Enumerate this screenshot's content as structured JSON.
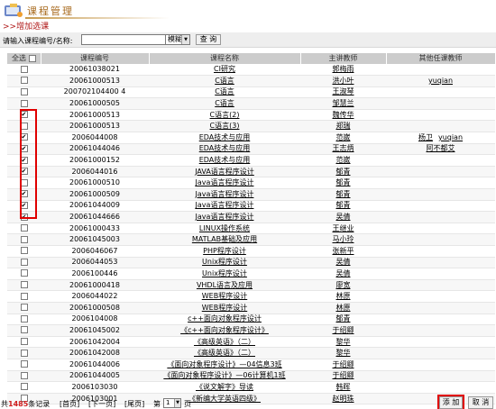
{
  "window": {
    "title": "课程管理"
  },
  "subhead": ">>增加选课",
  "search": {
    "label": "请输入课程编号/名称:",
    "value": "",
    "mode_selected": "模糊",
    "button_label": "查 询"
  },
  "table": {
    "headers": [
      "全选",
      "课程编号",
      "课程名称",
      "主讲教师",
      "其他任课教师"
    ],
    "rows": [
      {
        "checked": false,
        "code": "20061038021",
        "name": "CI研究",
        "teacher": "郭梅雨",
        "others": []
      },
      {
        "checked": false,
        "code": "20061000513",
        "name": "C语言",
        "teacher": "洪小叶",
        "others": [
          "yuqian"
        ]
      },
      {
        "checked": false,
        "code": "200702104400 4",
        "name": "C语言",
        "teacher": "王淑琴",
        "others": []
      },
      {
        "checked": false,
        "code": "20061000505",
        "name": "C语言",
        "teacher": "邹慧兰",
        "others": []
      },
      {
        "checked": true,
        "code": "20061000513",
        "name": "C语言(2)",
        "teacher": "魏传华",
        "others": []
      },
      {
        "checked": false,
        "code": "20061000513",
        "name": "C语言(3)",
        "teacher": "郑瑞",
        "others": []
      },
      {
        "checked": true,
        "code": "2006044008",
        "name": "EDA技术与应用",
        "teacher": "范崴",
        "others": [
          "杨卫",
          "yuqian"
        ]
      },
      {
        "checked": true,
        "code": "20061044046",
        "name": "EDA技术与应用",
        "teacher": "王志炳",
        "others": [
          "阿不都艾"
        ]
      },
      {
        "checked": true,
        "code": "20061000152",
        "name": "EDA技术与应用",
        "teacher": "范崴",
        "others": []
      },
      {
        "checked": true,
        "code": "2006044016",
        "name": "JAVA语言程序设计",
        "teacher": "郁青",
        "others": []
      },
      {
        "checked": false,
        "code": "20061000510",
        "name": "Java语言程序设计",
        "teacher": "郁青",
        "others": []
      },
      {
        "checked": true,
        "code": "20061000509",
        "name": "Java语言程序设计",
        "teacher": "郁青",
        "others": []
      },
      {
        "checked": true,
        "code": "20061044009",
        "name": "Java语言程序设计",
        "teacher": "郁青",
        "others": []
      },
      {
        "checked": true,
        "code": "20061044666",
        "name": "Java语言程序设计",
        "teacher": "吴倩",
        "others": []
      },
      {
        "checked": false,
        "code": "20061000433",
        "name": "LINUX操作系统",
        "teacher": "王继业",
        "others": []
      },
      {
        "checked": false,
        "code": "20061045003",
        "name": "MATLAB基础及应用",
        "teacher": "马小玲",
        "others": []
      },
      {
        "checked": false,
        "code": "2006046067",
        "name": "PHP程序设计",
        "teacher": "张新平",
        "others": []
      },
      {
        "checked": false,
        "code": "2006044053",
        "name": "Unix程序设计",
        "teacher": "吴倩",
        "others": []
      },
      {
        "checked": false,
        "code": "2006100446",
        "name": "Unix程序设计",
        "teacher": "吴倩",
        "others": []
      },
      {
        "checked": false,
        "code": "20061000418",
        "name": "VHDL语言及应用",
        "teacher": "廖宽",
        "others": []
      },
      {
        "checked": false,
        "code": "2006044022",
        "name": "WEB程序设计",
        "teacher": "林原",
        "others": []
      },
      {
        "checked": false,
        "code": "20061000508",
        "name": "WEB程序设计",
        "teacher": "林原",
        "others": []
      },
      {
        "checked": false,
        "code": "2006104008",
        "name": "c++面向对象程序设计",
        "teacher": "郁青",
        "others": []
      },
      {
        "checked": false,
        "code": "20061045002",
        "name": "《c++面向对象程序设计》",
        "teacher": "于绍卿",
        "others": []
      },
      {
        "checked": false,
        "code": "20061042004",
        "name": "《高级英语》（二）",
        "teacher": "黎华",
        "others": []
      },
      {
        "checked": false,
        "code": "20061042008",
        "name": "《高级英语》（二）",
        "teacher": "黎华",
        "others": []
      },
      {
        "checked": false,
        "code": "20061044006",
        "name": "《面向对象程序设计》—04信息3班",
        "teacher": "于绍卿",
        "others": []
      },
      {
        "checked": false,
        "code": "20061044005",
        "name": "《面向对象程序设计》—06计算机1班",
        "teacher": "于绍卿",
        "others": []
      },
      {
        "checked": false,
        "code": "2006103030",
        "name": "《说文解字》导读",
        "teacher": "韩晖",
        "others": []
      },
      {
        "checked": false,
        "code": "2006103001",
        "name": "《新编大学英语四级》",
        "teacher": "赵明珠",
        "others": []
      }
    ]
  },
  "pager": {
    "total_prefix": "共",
    "total_count": "1485",
    "total_suffix": "条记录",
    "first": "[首页]",
    "prev": "[下一页]",
    "last": "[尾页]",
    "page_prefix": "第",
    "page_value": "1",
    "page_suffix": "页"
  },
  "actions": {
    "add_label": "添 加",
    "cancel_label": "取 消"
  },
  "colors": {
    "title": "#a86a1e",
    "subhead": "#b01818",
    "highlight": "#e00000",
    "header_bg": "#cccccc"
  }
}
